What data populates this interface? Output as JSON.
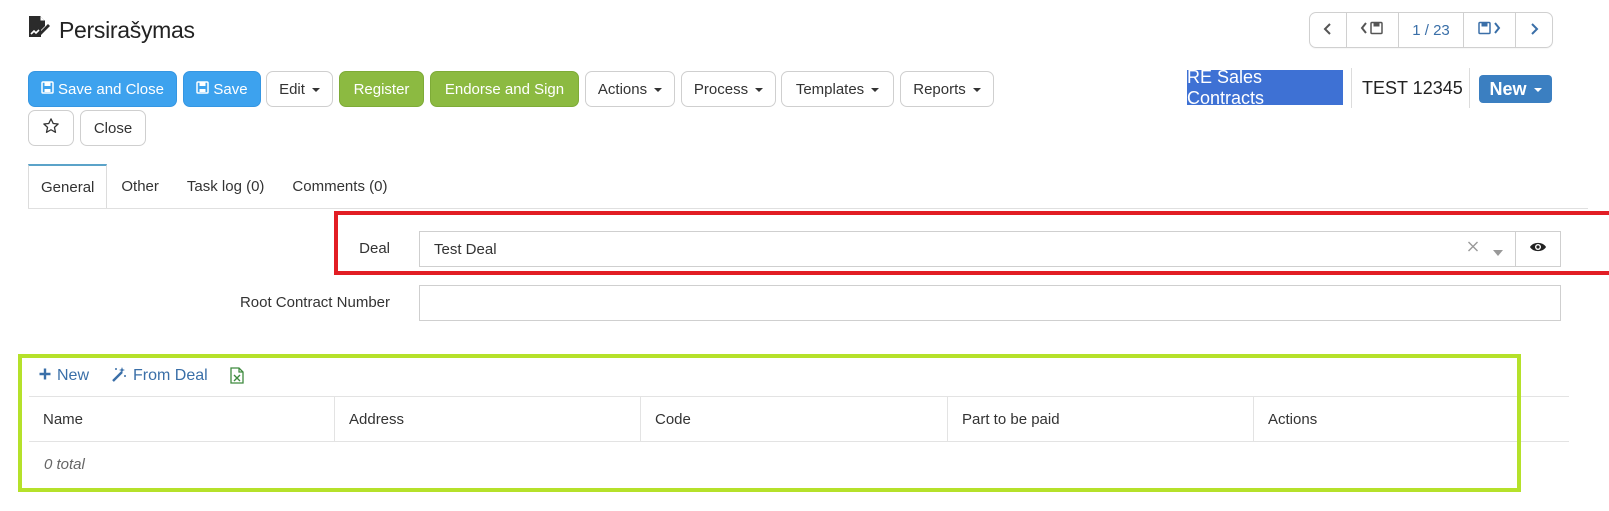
{
  "page": {
    "title": "Persirašymas",
    "title_icon": "edit-document-icon"
  },
  "pager": {
    "prev_icon": "chevron-left-icon",
    "prev_saved_icon": "save-previous-icon",
    "position": "1 / 23",
    "next_saved_icon": "save-next-icon",
    "next_icon": "chevron-right-icon"
  },
  "toolbar": {
    "save_close_label": "Save and Close",
    "save_label": "Save",
    "edit_label": "Edit",
    "register_label": "Register",
    "endorse_label": "Endorse and Sign",
    "actions_label": "Actions",
    "process_label": "Process",
    "templates_label": "Templates",
    "reports_label": "Reports",
    "favorite_icon": "star-icon",
    "close_label": "Close"
  },
  "header_right": {
    "type_label": "RE Sales Contracts",
    "record_name": "TEST 12345",
    "new_label": "New"
  },
  "tabs": [
    {
      "label": "General",
      "active": true
    },
    {
      "label": "Other"
    },
    {
      "label": "Task log (0)"
    },
    {
      "label": "Comments (0)"
    }
  ],
  "form": {
    "deal_label": "Deal",
    "deal_value": "Test Deal",
    "root_contract_label": "Root Contract Number",
    "root_contract_value": ""
  },
  "grid": {
    "new_label": "New",
    "from_deal_label": "From Deal",
    "columns": [
      "Name",
      "Address",
      "Code",
      "Part to be paid",
      "Actions"
    ],
    "total_text": "0 total"
  },
  "colors": {
    "primary_blue": "#3da2ee",
    "green": "#8cba41",
    "link_blue": "#3a6fa8",
    "annotation_red": "#e21d24",
    "annotation_green": "#b5e12a"
  }
}
